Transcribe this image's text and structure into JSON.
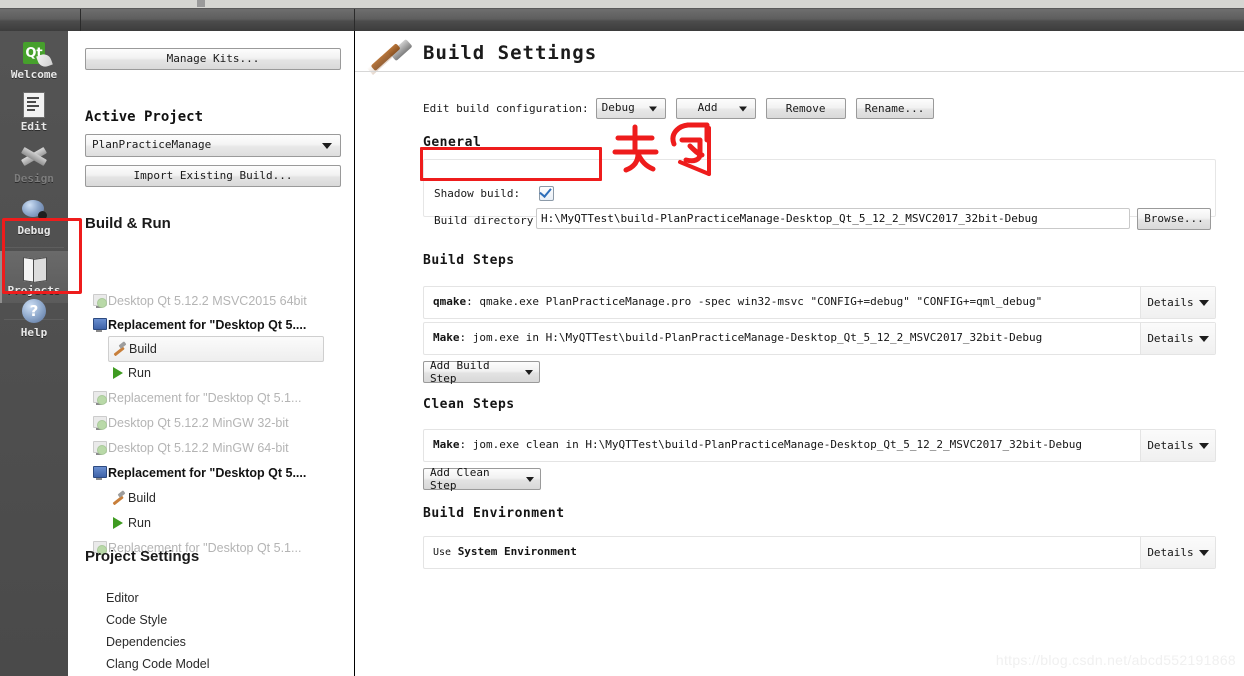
{
  "window": {
    "title": "Build Settings"
  },
  "mode_bar": {
    "items": [
      {
        "label": "Welcome",
        "icon": "qt-logo-icon",
        "state": "normal"
      },
      {
        "label": "Edit",
        "icon": "document-icon",
        "state": "normal"
      },
      {
        "label": "Design",
        "icon": "design-brush-icon",
        "state": "disabled"
      },
      {
        "label": "Debug",
        "icon": "bug-icon",
        "state": "normal"
      },
      {
        "label": "Projects",
        "icon": "projects-folder-icon",
        "state": "active"
      },
      {
        "label": "Help",
        "icon": "question-mark-icon",
        "state": "normal"
      }
    ]
  },
  "left_panel": {
    "manage_kits_label": "Manage Kits...",
    "active_project_heading": "Active Project",
    "active_project_value": "PlanPracticeManage",
    "import_existing_label": "Import Existing Build...",
    "build_run_heading": "Build & Run",
    "tree": [
      {
        "label": "Desktop Qt 5.12.2 MSVC2015 64bit",
        "icon": "kit-badge-icon",
        "indent": 0,
        "state": "disabled",
        "bold": false,
        "selected": false
      },
      {
        "label": "Replacement for \"Desktop Qt 5....",
        "icon": "kit-active-icon",
        "indent": 0,
        "state": "normal",
        "bold": true,
        "selected": false
      },
      {
        "label": "Build",
        "icon": "hammer-icon",
        "indent": 1,
        "state": "normal",
        "bold": false,
        "selected": true
      },
      {
        "label": "Run",
        "icon": "play-icon",
        "indent": 1,
        "state": "normal",
        "bold": false,
        "selected": false
      },
      {
        "label": "Replacement for \"Desktop Qt 5.1...",
        "icon": "kit-badge-icon",
        "indent": 0,
        "state": "disabled",
        "bold": false,
        "selected": false
      },
      {
        "label": "Desktop Qt 5.12.2 MinGW 32-bit",
        "icon": "kit-badge-icon",
        "indent": 0,
        "state": "disabled",
        "bold": false,
        "selected": false
      },
      {
        "label": "Desktop Qt 5.12.2 MinGW 64-bit",
        "icon": "kit-badge-icon",
        "indent": 0,
        "state": "disabled",
        "bold": false,
        "selected": false
      },
      {
        "label": "Replacement for \"Desktop Qt 5....",
        "icon": "kit-active-icon",
        "indent": 0,
        "state": "normal",
        "bold": true,
        "selected": false
      },
      {
        "label": "Build",
        "icon": "hammer-icon",
        "indent": 1,
        "state": "normal",
        "bold": false,
        "selected": false
      },
      {
        "label": "Run",
        "icon": "play-icon",
        "indent": 1,
        "state": "normal",
        "bold": false,
        "selected": false
      },
      {
        "label": "Replacement for \"Desktop Qt 5.1...",
        "icon": "kit-badge-icon",
        "indent": 0,
        "state": "disabled",
        "bold": false,
        "selected": false
      }
    ],
    "project_settings_heading": "Project Settings",
    "project_settings_items": [
      {
        "label": "Editor"
      },
      {
        "label": "Code Style"
      },
      {
        "label": "Dependencies"
      },
      {
        "label": "Clang Code Model"
      }
    ]
  },
  "main": {
    "title": "Build Settings",
    "config_row": {
      "label": "Edit build configuration:",
      "combo_value": "Debug",
      "add_label": "Add",
      "remove_label": "Remove",
      "rename_label": "Rename..."
    },
    "general": {
      "heading": "General",
      "shadow_build_label": "Shadow build:",
      "shadow_build_checked": true,
      "build_directory_label": "Build directory:",
      "build_directory_value": "H:\\MyQTTest\\build-PlanPracticeManage-Desktop_Qt_5_12_2_MSVC2017_32bit-Debug",
      "browse_label": "Browse..."
    },
    "build_steps": {
      "heading": "Build Steps",
      "details_label": "Details",
      "add_label": "Add Build Step",
      "steps": [
        {
          "name": "qmake",
          "command": "qmake.exe PlanPracticeManage.pro -spec win32-msvc \"CONFIG+=debug\" \"CONFIG+=qml_debug\""
        },
        {
          "name": "Make",
          "command": "jom.exe in H:\\MyQTTest\\build-PlanPracticeManage-Desktop_Qt_5_12_2_MSVC2017_32bit-Debug"
        }
      ]
    },
    "clean_steps": {
      "heading": "Clean Steps",
      "details_label": "Details",
      "add_label": "Add Clean Step",
      "steps": [
        {
          "name": "Make",
          "command": "jom.exe clean in H:\\MyQTTest\\build-PlanPracticeManage-Desktop_Qt_5_12_2_MSVC2017_32bit-Debug"
        }
      ]
    },
    "build_environment": {
      "heading": "Build Environment",
      "prefix": "Use",
      "value": "System Environment",
      "details_label": "Details"
    }
  },
  "annotations": {
    "color": "#ee1c1c",
    "note_text": "去勾",
    "targets": [
      "projects-mode-button",
      "shadow-build-checkbox"
    ]
  },
  "watermark": {
    "text": "https://blog.csdn.net/abcd552191868"
  }
}
